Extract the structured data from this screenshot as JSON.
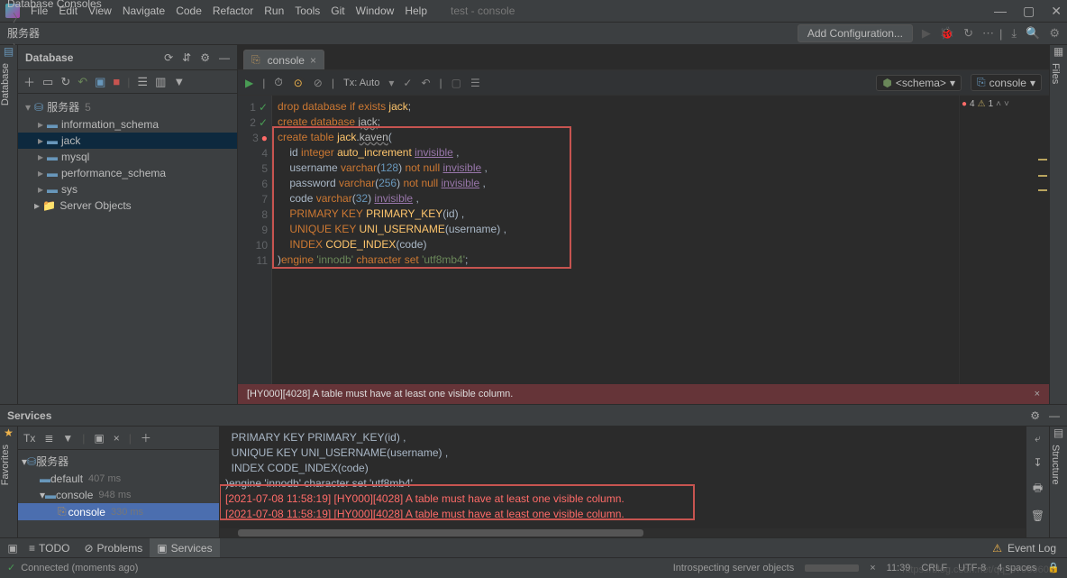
{
  "window_title": "test - console",
  "menubar": {
    "items": [
      "File",
      "Edit",
      "View",
      "Navigate",
      "Code",
      "Refactor",
      "Run",
      "Tools",
      "Git",
      "Window",
      "Help"
    ]
  },
  "breadcrumb": {
    "items": [
      {
        "label": "Database Consoles",
        "icon": "▭"
      },
      {
        "label": "服务器",
        "icon": "▭"
      },
      {
        "label": "console",
        "icon": "sql"
      }
    ]
  },
  "add_config_label": "Add Configuration...",
  "left_gutter_tab": "Database",
  "right_gutter_tab": "Files",
  "database_panel": {
    "title": "Database",
    "toolbar": [
      "add",
      "refresh",
      "rollback",
      "commit",
      "stop",
      "divider",
      "rows",
      "columns",
      "filter"
    ],
    "tree": {
      "root": {
        "label": "服务器",
        "count": "5"
      },
      "children": [
        {
          "label": "information_schema"
        },
        {
          "label": "jack",
          "selected": true
        },
        {
          "label": "mysql"
        },
        {
          "label": "performance_schema"
        },
        {
          "label": "sys"
        },
        {
          "label": "Server Objects",
          "icon": "folder"
        }
      ]
    }
  },
  "editor": {
    "tab": {
      "label": "console"
    },
    "toolbar": {
      "tx_label": "Tx: Auto",
      "schema_pill": "<schema>",
      "console_pill": "console"
    },
    "error_marks": {
      "errors": 4,
      "warnings": 1
    },
    "code": [
      {
        "n": 1,
        "g": "ok",
        "tokens": [
          [
            "kw",
            "drop database if exists"
          ],
          [
            "txt",
            " "
          ],
          [
            "id",
            "jack"
          ],
          [
            "txt",
            ";"
          ]
        ]
      },
      {
        "n": 2,
        "g": "ok",
        "tokens": [
          [
            "kw",
            "create database"
          ],
          [
            "txt",
            " "
          ],
          [
            "und",
            "jack"
          ],
          [
            "txt",
            ";"
          ]
        ]
      },
      {
        "n": 3,
        "g": "err",
        "tokens": [
          [
            "kw",
            "create table"
          ],
          [
            "txt",
            " "
          ],
          [
            "id",
            "jack"
          ],
          [
            "txt",
            "."
          ],
          [
            "und",
            "kaven"
          ],
          [
            "txt",
            "("
          ]
        ]
      },
      {
        "n": 4,
        "g": "none",
        "tokens": [
          [
            "txt",
            "    "
          ],
          [
            "txt",
            "id "
          ],
          [
            "kw",
            "integer"
          ],
          [
            "txt",
            " "
          ],
          [
            "id",
            "auto_increment"
          ],
          [
            "txt",
            " "
          ],
          [
            "inv",
            "invisible"
          ],
          [
            "txt",
            " , "
          ]
        ]
      },
      {
        "n": 5,
        "g": "none",
        "tokens": [
          [
            "txt",
            "    "
          ],
          [
            "txt",
            "username "
          ],
          [
            "kw",
            "varchar"
          ],
          [
            "txt",
            "("
          ],
          [
            "num",
            "128"
          ],
          [
            "txt",
            ") "
          ],
          [
            "kw",
            "not null"
          ],
          [
            "txt",
            " "
          ],
          [
            "inv",
            "invisible"
          ],
          [
            "txt",
            " ,"
          ]
        ]
      },
      {
        "n": 6,
        "g": "none",
        "tokens": [
          [
            "txt",
            "    "
          ],
          [
            "txt",
            "password "
          ],
          [
            "kw",
            "varchar"
          ],
          [
            "txt",
            "("
          ],
          [
            "num",
            "256"
          ],
          [
            "txt",
            ") "
          ],
          [
            "kw",
            "not null"
          ],
          [
            "txt",
            " "
          ],
          [
            "inv",
            "invisible"
          ],
          [
            "txt",
            " ,"
          ]
        ]
      },
      {
        "n": 7,
        "g": "none",
        "tokens": [
          [
            "txt",
            "    "
          ],
          [
            "txt",
            "code "
          ],
          [
            "kw",
            "varchar"
          ],
          [
            "txt",
            "("
          ],
          [
            "num",
            "32"
          ],
          [
            "txt",
            ") "
          ],
          [
            "inv",
            "invisible"
          ],
          [
            "txt",
            " ,"
          ]
        ]
      },
      {
        "n": 8,
        "g": "none",
        "tokens": [
          [
            "txt",
            "    "
          ],
          [
            "kw",
            "PRIMARY KEY"
          ],
          [
            "txt",
            " "
          ],
          [
            "id",
            "PRIMARY_KEY"
          ],
          [
            "txt",
            "("
          ],
          [
            "txt",
            "id"
          ],
          [
            "txt",
            ") ,"
          ]
        ]
      },
      {
        "n": 9,
        "g": "none",
        "tokens": [
          [
            "txt",
            "    "
          ],
          [
            "kw",
            "UNIQUE KEY"
          ],
          [
            "txt",
            " "
          ],
          [
            "id",
            "UNI_USERNAME"
          ],
          [
            "txt",
            "("
          ],
          [
            "txt",
            "username"
          ],
          [
            "txt",
            ") ,"
          ]
        ]
      },
      {
        "n": 10,
        "g": "none",
        "tokens": [
          [
            "txt",
            "    "
          ],
          [
            "kw",
            "INDEX"
          ],
          [
            "txt",
            " "
          ],
          [
            "id",
            "CODE_INDEX"
          ],
          [
            "txt",
            "("
          ],
          [
            "txt",
            "code"
          ],
          [
            "txt",
            ")"
          ]
        ]
      },
      {
        "n": 11,
        "g": "none",
        "tokens": [
          [
            "txt",
            ")"
          ],
          [
            "kw",
            "engine"
          ],
          [
            "txt",
            " "
          ],
          [
            "str",
            "'innodb'"
          ],
          [
            "txt",
            " "
          ],
          [
            "kw",
            "character set"
          ],
          [
            "txt",
            " "
          ],
          [
            "str",
            "'utf8mb4'"
          ],
          [
            "txt",
            ";"
          ]
        ]
      }
    ],
    "error_banner": "[HY000][4028] A table must have at least one visible column."
  },
  "services": {
    "title": "Services",
    "left_gutter_tab": "Favorites",
    "toolbar": [
      "Tx",
      "tree",
      "filter",
      "divider",
      "window",
      "close"
    ],
    "tree": [
      {
        "label": "服务器",
        "icon": "db",
        "indent": 0,
        "expand": "v"
      },
      {
        "label": "default",
        "ms": "407 ms",
        "indent": 1
      },
      {
        "label": "console",
        "ms": "948 ms",
        "indent": 1,
        "expand": "v"
      },
      {
        "label": "console",
        "ms": "330 ms",
        "indent": 2,
        "selected": true,
        "icon": "sql"
      }
    ],
    "output": [
      {
        "cls": "txt",
        "text": "  PRIMARY KEY PRIMARY_KEY(id) ,"
      },
      {
        "cls": "txt",
        "text": "  UNIQUE KEY UNI_USERNAME(username) ,"
      },
      {
        "cls": "txt",
        "text": "  INDEX CODE_INDEX(code)"
      },
      {
        "cls": "txt",
        "text": ")engine 'innodb' character set 'utf8mb4'"
      },
      {
        "cls": "logerr",
        "text": "[2021-07-08 11:58:19] [HY000][4028] A table must have at least one visible column."
      },
      {
        "cls": "logerr",
        "text": "[2021-07-08 11:58:19] [HY000][4028] A table must have at least one visible column."
      }
    ]
  },
  "bottom_tabs": {
    "items": [
      {
        "icon": "≡",
        "label": "TODO"
      },
      {
        "icon": "⊘",
        "label": "Problems"
      },
      {
        "icon": "▣",
        "label": "Services",
        "active": true
      }
    ],
    "event_log": "Event Log"
  },
  "statusbar": {
    "connected": "Connected (moments ago)",
    "progress_label": "Introspecting server objects",
    "pos": "11:39",
    "crlf": "CRLF",
    "encoding": "UTF-8",
    "indent": "4 spaces"
  },
  "watermark": "https://blog.csdn.net/qq_37960603"
}
